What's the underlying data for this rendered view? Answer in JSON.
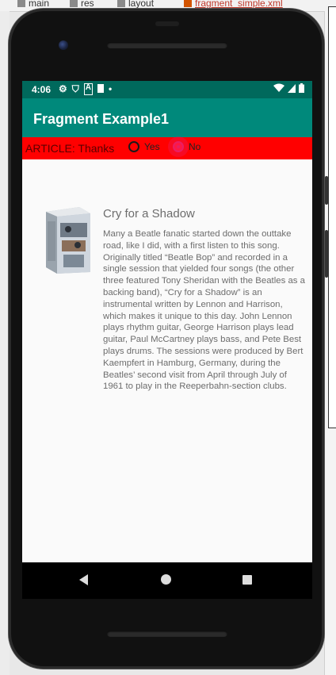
{
  "ide": {
    "tabs": [
      "main",
      "res",
      "layout",
      "fragment_simple.xml"
    ]
  },
  "status_bar": {
    "time": "4:06",
    "icons_left": [
      "gear-icon",
      "shield-icon",
      "a-icon",
      "sd-card-icon",
      "dot-icon"
    ],
    "icons_right": [
      "wifi-icon",
      "cell-signal-icon",
      "battery-icon"
    ]
  },
  "app_bar": {
    "title": "Fragment Example1"
  },
  "article_bar": {
    "text": "ARTICLE: Thanks",
    "options": [
      {
        "label": "Yes",
        "checked": false
      },
      {
        "label": "No",
        "checked": true
      }
    ]
  },
  "song": {
    "title": "Cry for a Shadow",
    "description": "Many a Beatle fanatic started down the outtake road, like I did, with a first listen to this song. Originally titled “Beatle Bop” and recorded in a single session that yielded four songs (the other three featured Tony Sheridan with the Beatles as a backing band), “Cry for a Shadow” is an instrumental written by Lennon and Harrison, which makes it unique to this day. John Lennon plays rhythm guitar, George Harrison plays lead guitar, Paul McCartney plays bass, and Pete Best plays drums. The sessions were produced by Bert Kaempfert in Hamburg, Germany, during the Beatles’ second visit from April through July of 1961 to play in the Reeperbahn-section clubs."
  },
  "colors": {
    "status_bar": "#00695c",
    "app_bar": "#00897b",
    "article_bar": "#ff0000",
    "radio_checked": "#e91e63"
  }
}
